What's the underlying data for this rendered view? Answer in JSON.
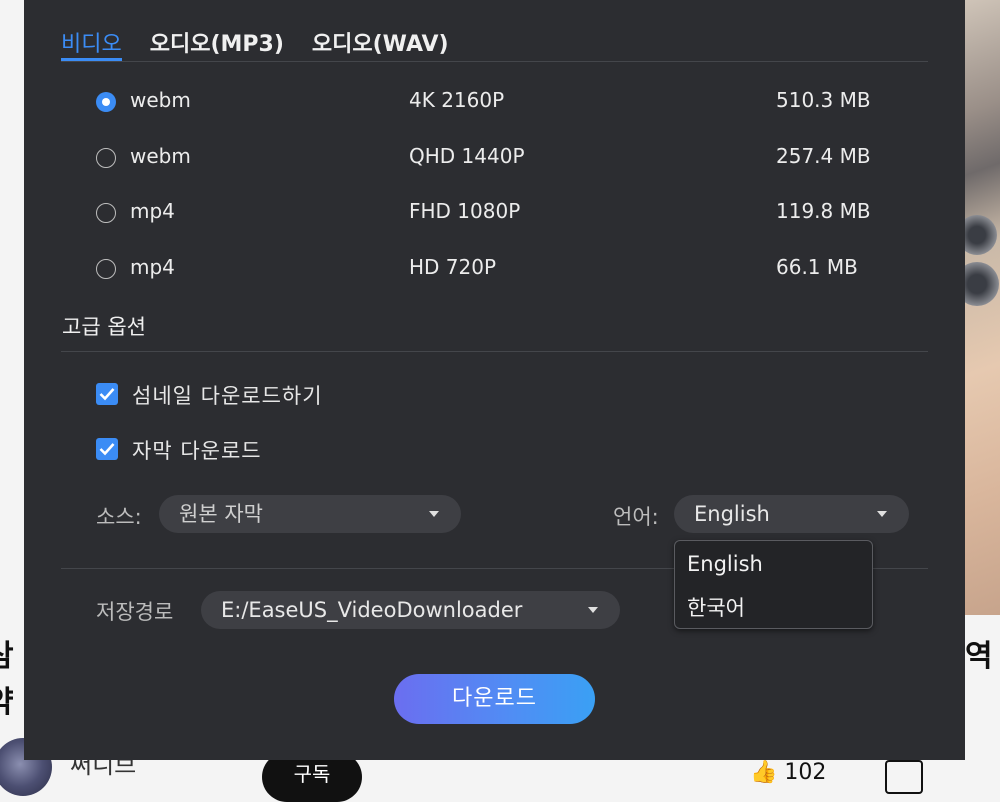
{
  "background": {
    "left_text": [
      "삼",
      "약"
    ],
    "right_text": "역",
    "channel_name": "써니브",
    "subscribe_label": "구독",
    "like_count": "102"
  },
  "tabs": [
    {
      "label": "비디오",
      "active": true
    },
    {
      "label": "오디오(MP3)",
      "active": false
    },
    {
      "label": "오디오(WAV)",
      "active": false
    }
  ],
  "formats": [
    {
      "format": "webm",
      "resolution": "4K 2160P",
      "size": "510.3 MB",
      "selected": true
    },
    {
      "format": "webm",
      "resolution": "QHD 1440P",
      "size": "257.4 MB",
      "selected": false
    },
    {
      "format": "mp4",
      "resolution": "FHD 1080P",
      "size": "119.8 MB",
      "selected": false
    },
    {
      "format": "mp4",
      "resolution": "HD 720P",
      "size": "66.1 MB",
      "selected": false
    }
  ],
  "advanced": {
    "title": "고급 옵션",
    "thumbnail_label": "섬네일 다운로드하기",
    "thumbnail_checked": true,
    "subtitle_label": "자막 다운로드",
    "subtitle_checked": true,
    "source_label": "소스:",
    "source_value": "원본 자막",
    "language_label": "언어:",
    "language_value": "English",
    "language_options": [
      "English",
      "한국어"
    ]
  },
  "save": {
    "label": "저장경로",
    "path": "E:/EaseUS_VideoDownloader"
  },
  "download_label": "다운로드",
  "colors": {
    "accent": "#3b8cf5",
    "modal_bg": "#2c2d31",
    "button_gradient_start": "#6b6ef0",
    "button_gradient_end": "#3aa0f4"
  }
}
